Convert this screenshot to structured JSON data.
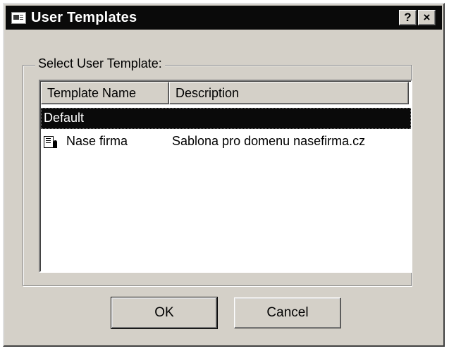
{
  "window": {
    "title": "User Templates",
    "help_label": "?",
    "close_label": "×"
  },
  "group": {
    "label": "Select User Template:"
  },
  "list": {
    "columns": [
      "Template Name",
      "Description"
    ],
    "rows": [
      {
        "name": "Default",
        "description": "",
        "selected": true
      },
      {
        "name": "Nase firma",
        "description": "Sablona pro domenu nasefirma.cz",
        "selected": false
      }
    ]
  },
  "buttons": {
    "ok_label": "OK",
    "cancel_label": "Cancel"
  }
}
